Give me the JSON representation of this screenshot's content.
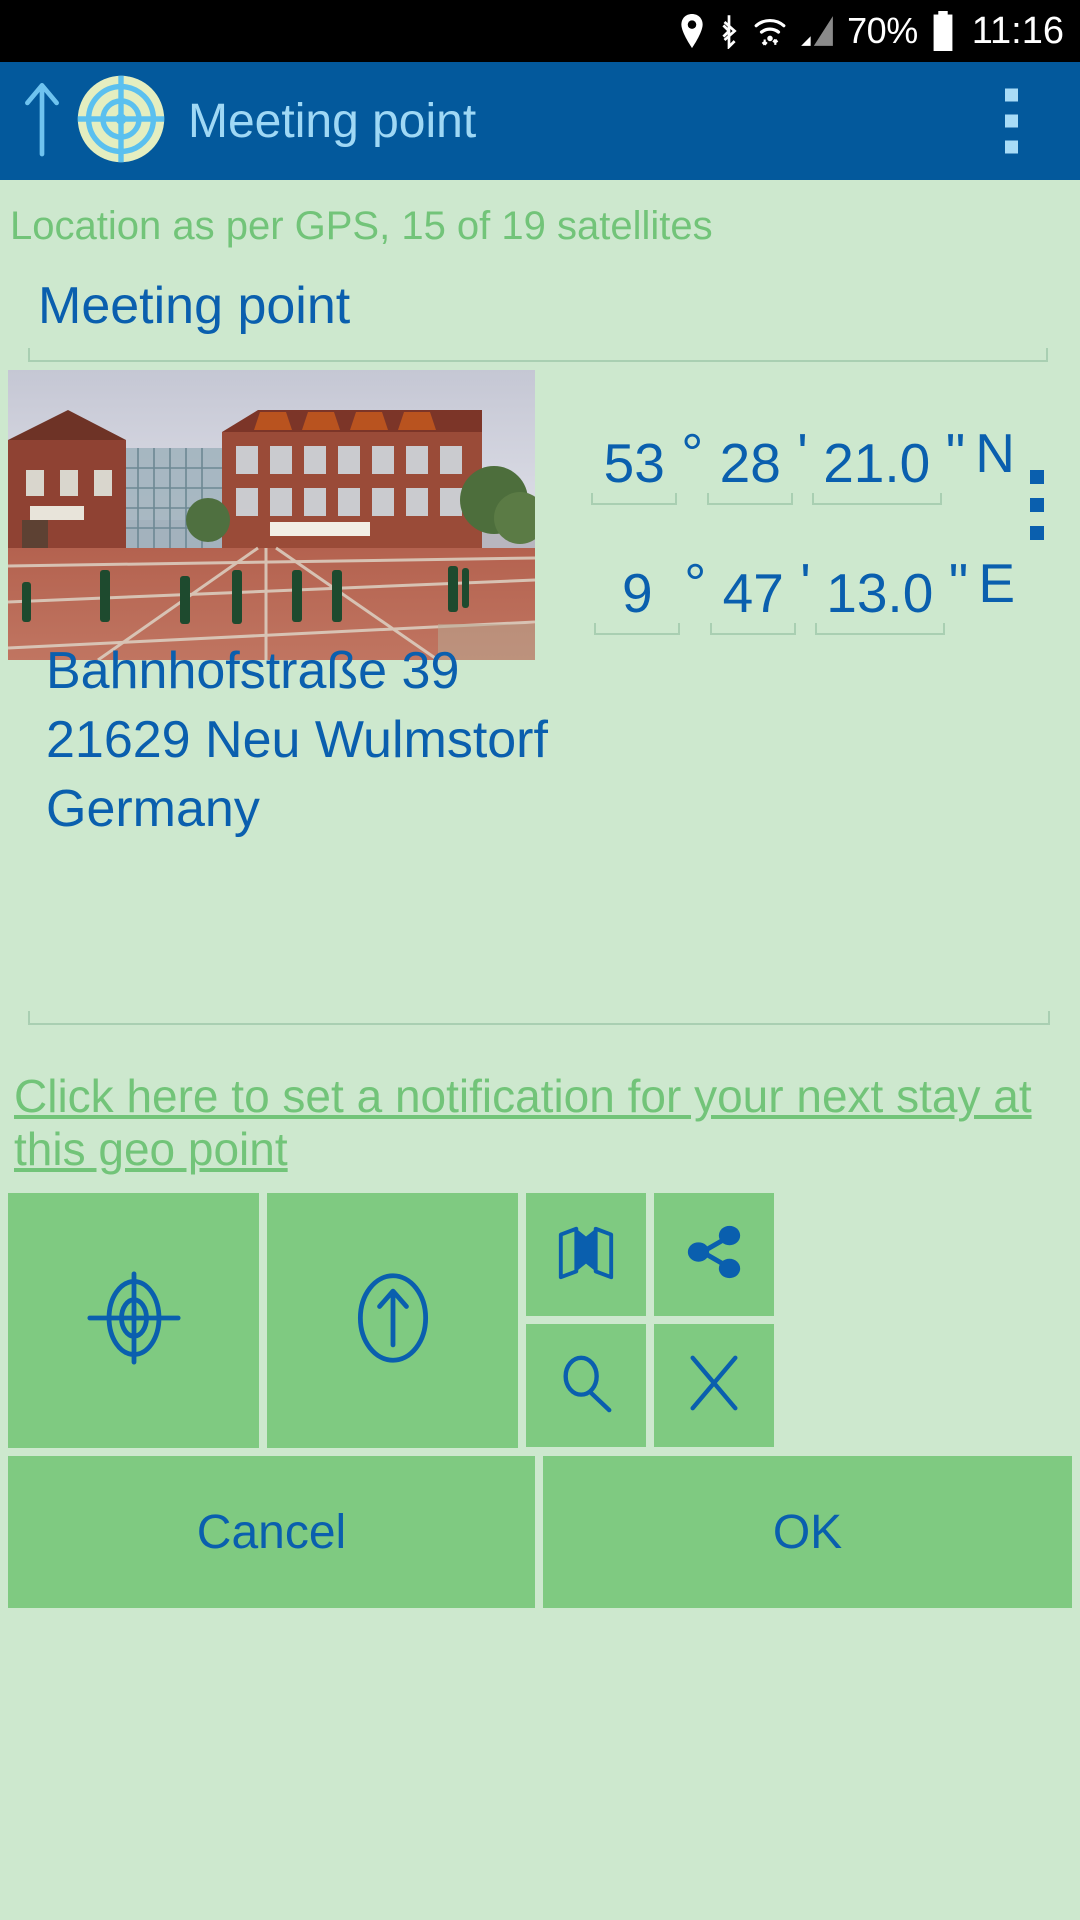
{
  "statusbar": {
    "battery_percent": "70%",
    "clock": "11:16",
    "icons": [
      "location-pin-icon",
      "bluetooth-icon",
      "wifi-icon",
      "cellular-signal-icon",
      "battery-icon"
    ]
  },
  "appbar": {
    "title": "Meeting point",
    "up_icon": "arrow-up-icon",
    "logo_icon": "crosshair-target-icon",
    "overflow_icon": "overflow-menu-icon",
    "background_color": "#03599c",
    "title_color": "#9fd8f5"
  },
  "content": {
    "gps_status": "Location as per GPS, 15 of 19 satellites",
    "gps_status_color": "#72c479",
    "title_field": {
      "value": "Meeting point",
      "placeholder": "Meeting point"
    },
    "photo_alt": "town-hall-photo",
    "coordinates": {
      "latitude": {
        "degrees": "53",
        "degree_symbol": "°",
        "minutes": "28",
        "minute_symbol": "'",
        "seconds": "21.0",
        "second_symbol": "\"",
        "hemisphere": "N"
      },
      "longitude": {
        "degrees": "9",
        "degree_symbol": "°",
        "minutes": "47",
        "minute_symbol": "'",
        "seconds": "13.0",
        "second_symbol": "\"",
        "hemisphere": "E"
      },
      "overflow_icon": "overflow-menu-icon"
    },
    "address": {
      "line1": "Bahnhofstraße 39",
      "line2": "21629 Neu Wulmstorf",
      "line3": "Germany"
    },
    "notes_placeholder": "",
    "notification_link": "Click here to set a notification for your next stay at this geo point"
  },
  "buttons": {
    "tiles": [
      {
        "name": "locate-button",
        "icon": "crosshair-target-icon"
      },
      {
        "name": "navigate-button",
        "icon": "arrow-up-circle-icon"
      },
      {
        "name": "map-button",
        "icon": "map-icon"
      },
      {
        "name": "share-button",
        "icon": "share-icon"
      },
      {
        "name": "search-button",
        "icon": "magnifier-icon"
      },
      {
        "name": "clear-button",
        "icon": "close-x-icon"
      }
    ],
    "cancel_label": "Cancel",
    "ok_label": "OK"
  },
  "theme": {
    "page_background": "#cde8ce",
    "tile_background": "#7fca81",
    "accent_blue": "#0a5fae",
    "accent_green": "#72c479",
    "underline": "#a9cfb2"
  }
}
